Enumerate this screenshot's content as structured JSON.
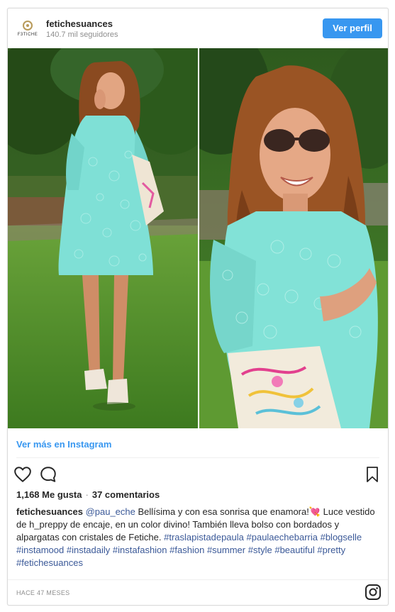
{
  "header": {
    "username": "fetichesuances",
    "followers": "140.7 mil seguidores",
    "view_profile_label": "Ver perfil",
    "avatar_text": "F3TICHE"
  },
  "photos": {
    "left_desc": "woman in turquoise lace dress holding clutch",
    "right_desc": "woman in turquoise lace dress with sunglasses"
  },
  "view_more_label": "Ver más en Instagram",
  "actions": {
    "icons": [
      "heart-icon",
      "comment-icon",
      "bookmark-icon"
    ]
  },
  "stats": {
    "likes": "1,168 Me gusta",
    "separator": "·",
    "comments": "37 comentarios"
  },
  "caption": {
    "username": "fetichesuances",
    "mention": "@pau_eche",
    "text": "Bellísima y con esa sonrisa que enamora!💘 Luce vestido de h_preppy de encaje, en un color divino! También lleva bolso con bordados y alpargatas con cristales de Fetiche.",
    "hashtags": [
      "#traslapistadepaula",
      "#paulaechebarria",
      "#blogselle",
      "#instamood",
      "#instadaily",
      "#instafashion",
      "#fashion",
      "#summer",
      "#style",
      "#beautiful",
      "#pretty",
      "#fetichesuances"
    ]
  },
  "timestamp": "HACE 47 MESES",
  "colors": {
    "accent": "#3897f0",
    "link": "#3b5998",
    "dress": "#7fe0d6",
    "grass": "#4f8f2a"
  }
}
